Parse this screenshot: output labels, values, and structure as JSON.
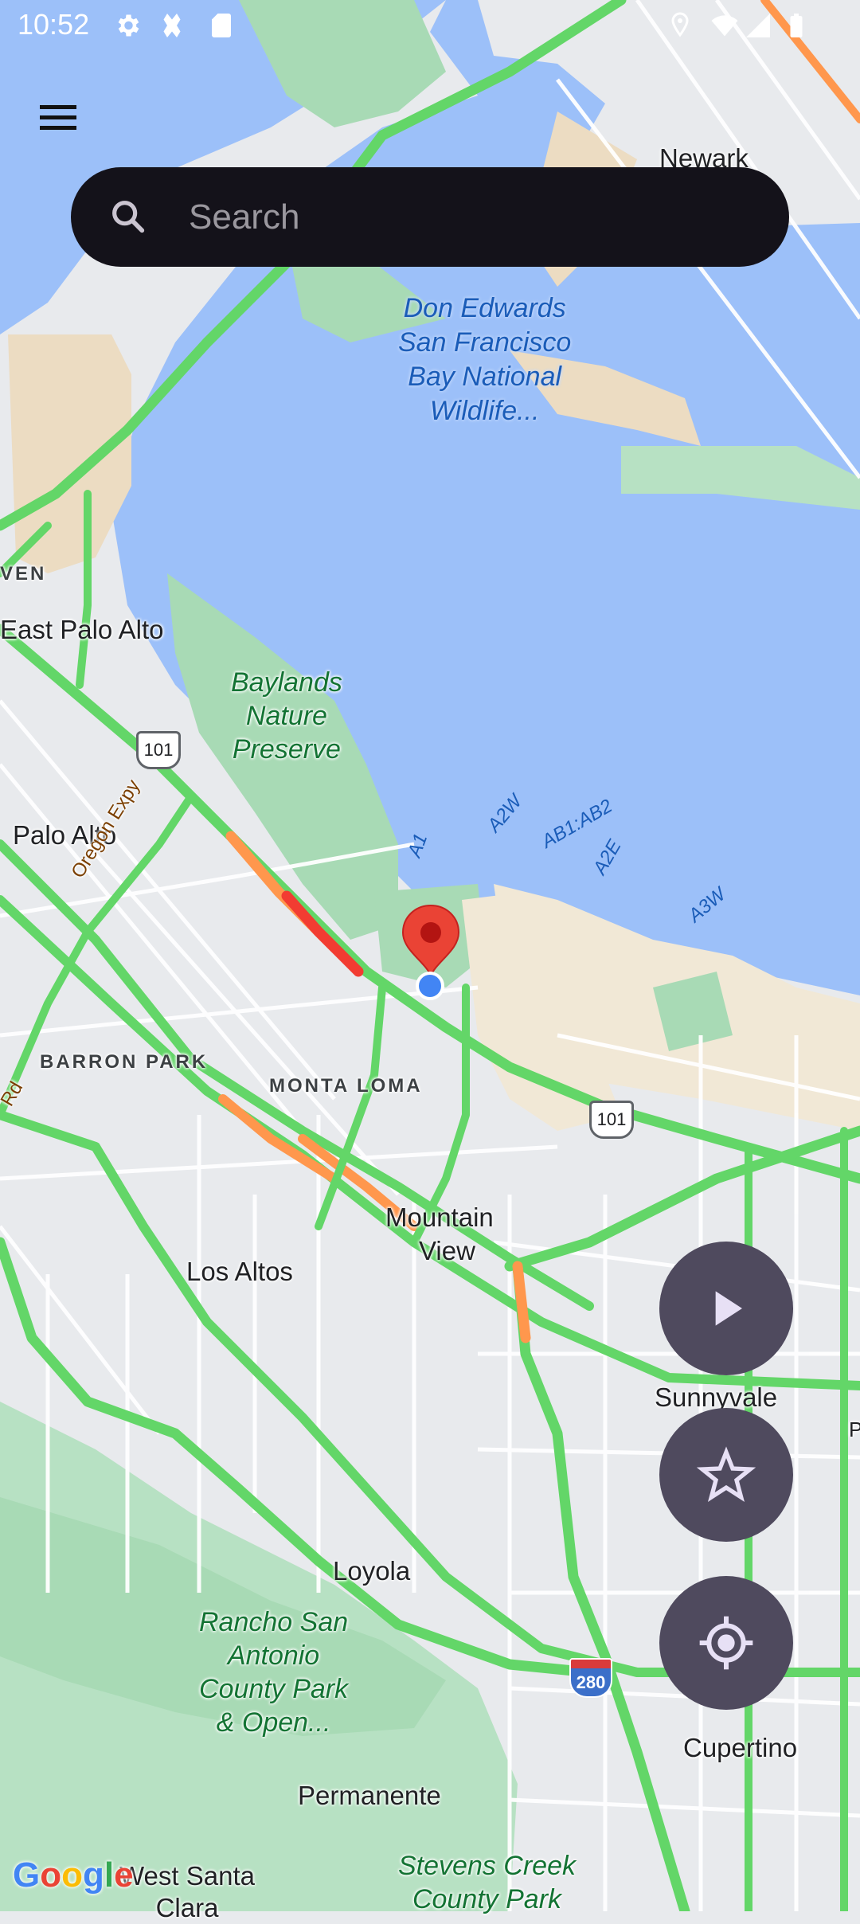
{
  "status_bar": {
    "time": "10:52",
    "left_icons": [
      "gear-icon",
      "sim-toolkit-icon",
      "sd-card-icon"
    ],
    "right_icons": [
      "location-icon",
      "wifi-icon",
      "signal-icon",
      "battery-icon"
    ]
  },
  "toolbar": {
    "menu_icon": "hamburger-menu-icon",
    "search": {
      "placeholder": "Search",
      "value": "",
      "icon": "search-icon"
    }
  },
  "fabs": [
    {
      "name": "play-button",
      "icon": "play-icon"
    },
    {
      "name": "favorites-button",
      "icon": "star-outline-icon"
    },
    {
      "name": "my-location-button",
      "icon": "gps-fixed-icon"
    }
  ],
  "map": {
    "attribution": "Google",
    "colors": {
      "water": "#9cc0f9",
      "land": "#e8eaed",
      "park": "#a8dab5",
      "traffic_fast": "#63d668",
      "traffic_medium": "#ff974d",
      "traffic_slow": "#f23c32",
      "marker": "#ea4335",
      "location_dot": "#4285f4"
    },
    "cities": [
      "Newark",
      "East Palo Alto",
      "Palo Alto",
      "Mountain View",
      "Los Altos",
      "Sunnyvale",
      "Loyola",
      "Cupertino",
      "Permanente",
      "West Santa Clara"
    ],
    "city_labels": {
      "newark": "Newark",
      "east_palo_alto": "East Palo Alto",
      "palo_alto": "Palo Alto",
      "mountain": "Mountain",
      "view": "View",
      "los_altos": "Los Altos",
      "sunnyvale": "Sunnyvale",
      "loyola": "Loyola",
      "cupertino": "Cupertino",
      "permanente": "Permanente",
      "west_santa": "West Santa",
      "clara": "Clara",
      "p_partial": "P"
    },
    "neighborhoods": {
      "barron_park": "BARRON PARK",
      "monta_loma": "MONTA LOMA",
      "ven_partial": "VEN"
    },
    "parks": {
      "don_edwards": [
        "Don Edwards",
        "San Francisco",
        "Bay National",
        "Wildlife..."
      ],
      "baylands": [
        "Baylands",
        "Nature",
        "Preserve"
      ],
      "rancho": [
        "Rancho San",
        "Antonio",
        "County Park",
        "& Open..."
      ],
      "stevens": [
        "Stevens Creek",
        "County Park"
      ]
    },
    "ponds": {
      "a1": "A1",
      "a2w": "A2W",
      "ab1ab2": "AB1:AB2",
      "a2e": "A2E",
      "a3w": "A3W"
    },
    "roads": {
      "oregon_expy": "Oregon Expy",
      "rd_partial": "Rd"
    },
    "shields": {
      "us101_a": "101",
      "us101_b": "101",
      "i280": "280"
    }
  }
}
